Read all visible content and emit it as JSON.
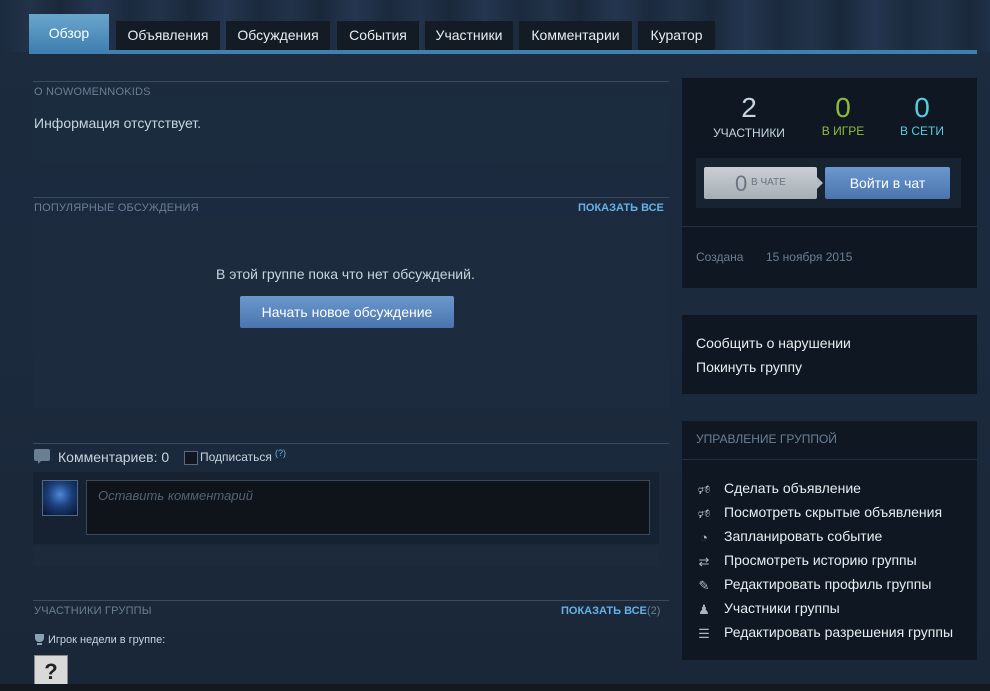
{
  "tabs": [
    {
      "label": "Обзор",
      "active": true
    },
    {
      "label": "Объявления"
    },
    {
      "label": "Обсуждения"
    },
    {
      "label": "События"
    },
    {
      "label": "Участники"
    },
    {
      "label": "Комментарии"
    },
    {
      "label": "Куратор"
    }
  ],
  "about": {
    "caption": "О NOWOMENNOKIDS",
    "text": "Информация отсутствует."
  },
  "discussions": {
    "caption": "ПОПУЛЯРНЫЕ ОБСУЖДЕНИЯ",
    "show_all": "ПОКАЗАТЬ ВСЕ",
    "empty_text": "В этой группе пока что нет обсуждений.",
    "new_button": "Начать новое обсуждение"
  },
  "comments": {
    "title": "Комментариев: 0",
    "subscribe": "Подписаться",
    "help_mark": "(?)",
    "placeholder": "Оставить комментарий"
  },
  "members": {
    "caption": "УЧАСТНИКИ ГРУППЫ",
    "show_all": "ПОКАЗАТЬ ВСЕ",
    "count": "(2)",
    "player_of_week": "Игрок недели в группе:",
    "unknown_avatar": "?"
  },
  "stats": {
    "members_count": "2",
    "members_label": "УЧАСТНИКИ",
    "ingame_count": "0",
    "ingame_label": "В ИГРЕ",
    "online_count": "0",
    "online_label": "В СЕТИ",
    "chat_count": "0",
    "chat_label": "В ЧАТЕ",
    "chat_button": "Войти в чат",
    "created_label": "Создана",
    "created_date": "15 ноября 2015"
  },
  "actions": {
    "report": "Сообщить о нарушении",
    "leave": "Покинуть группу"
  },
  "management": {
    "caption": "УПРАВЛЕНИЕ ГРУППОЙ",
    "items": [
      {
        "label": "Сделать объявление",
        "icon": "megaphone-icon"
      },
      {
        "label": "Посмотреть скрытые объявления",
        "icon": "megaphone-icon"
      },
      {
        "label": "Запланировать событие",
        "icon": "clock-icon"
      },
      {
        "label": "Просмотреть историю группы",
        "icon": "history-icon"
      },
      {
        "label": "Редактировать профиль группы",
        "icon": "pencil-icon"
      },
      {
        "label": "Участники группы",
        "icon": "people-icon"
      },
      {
        "label": "Редактировать разрешения группы",
        "icon": "permissions-icon"
      }
    ]
  },
  "colors": {
    "accent": "#3f80b0",
    "ingame": "#90ba3c",
    "online": "#57cbde",
    "link": "#66b2e8"
  }
}
